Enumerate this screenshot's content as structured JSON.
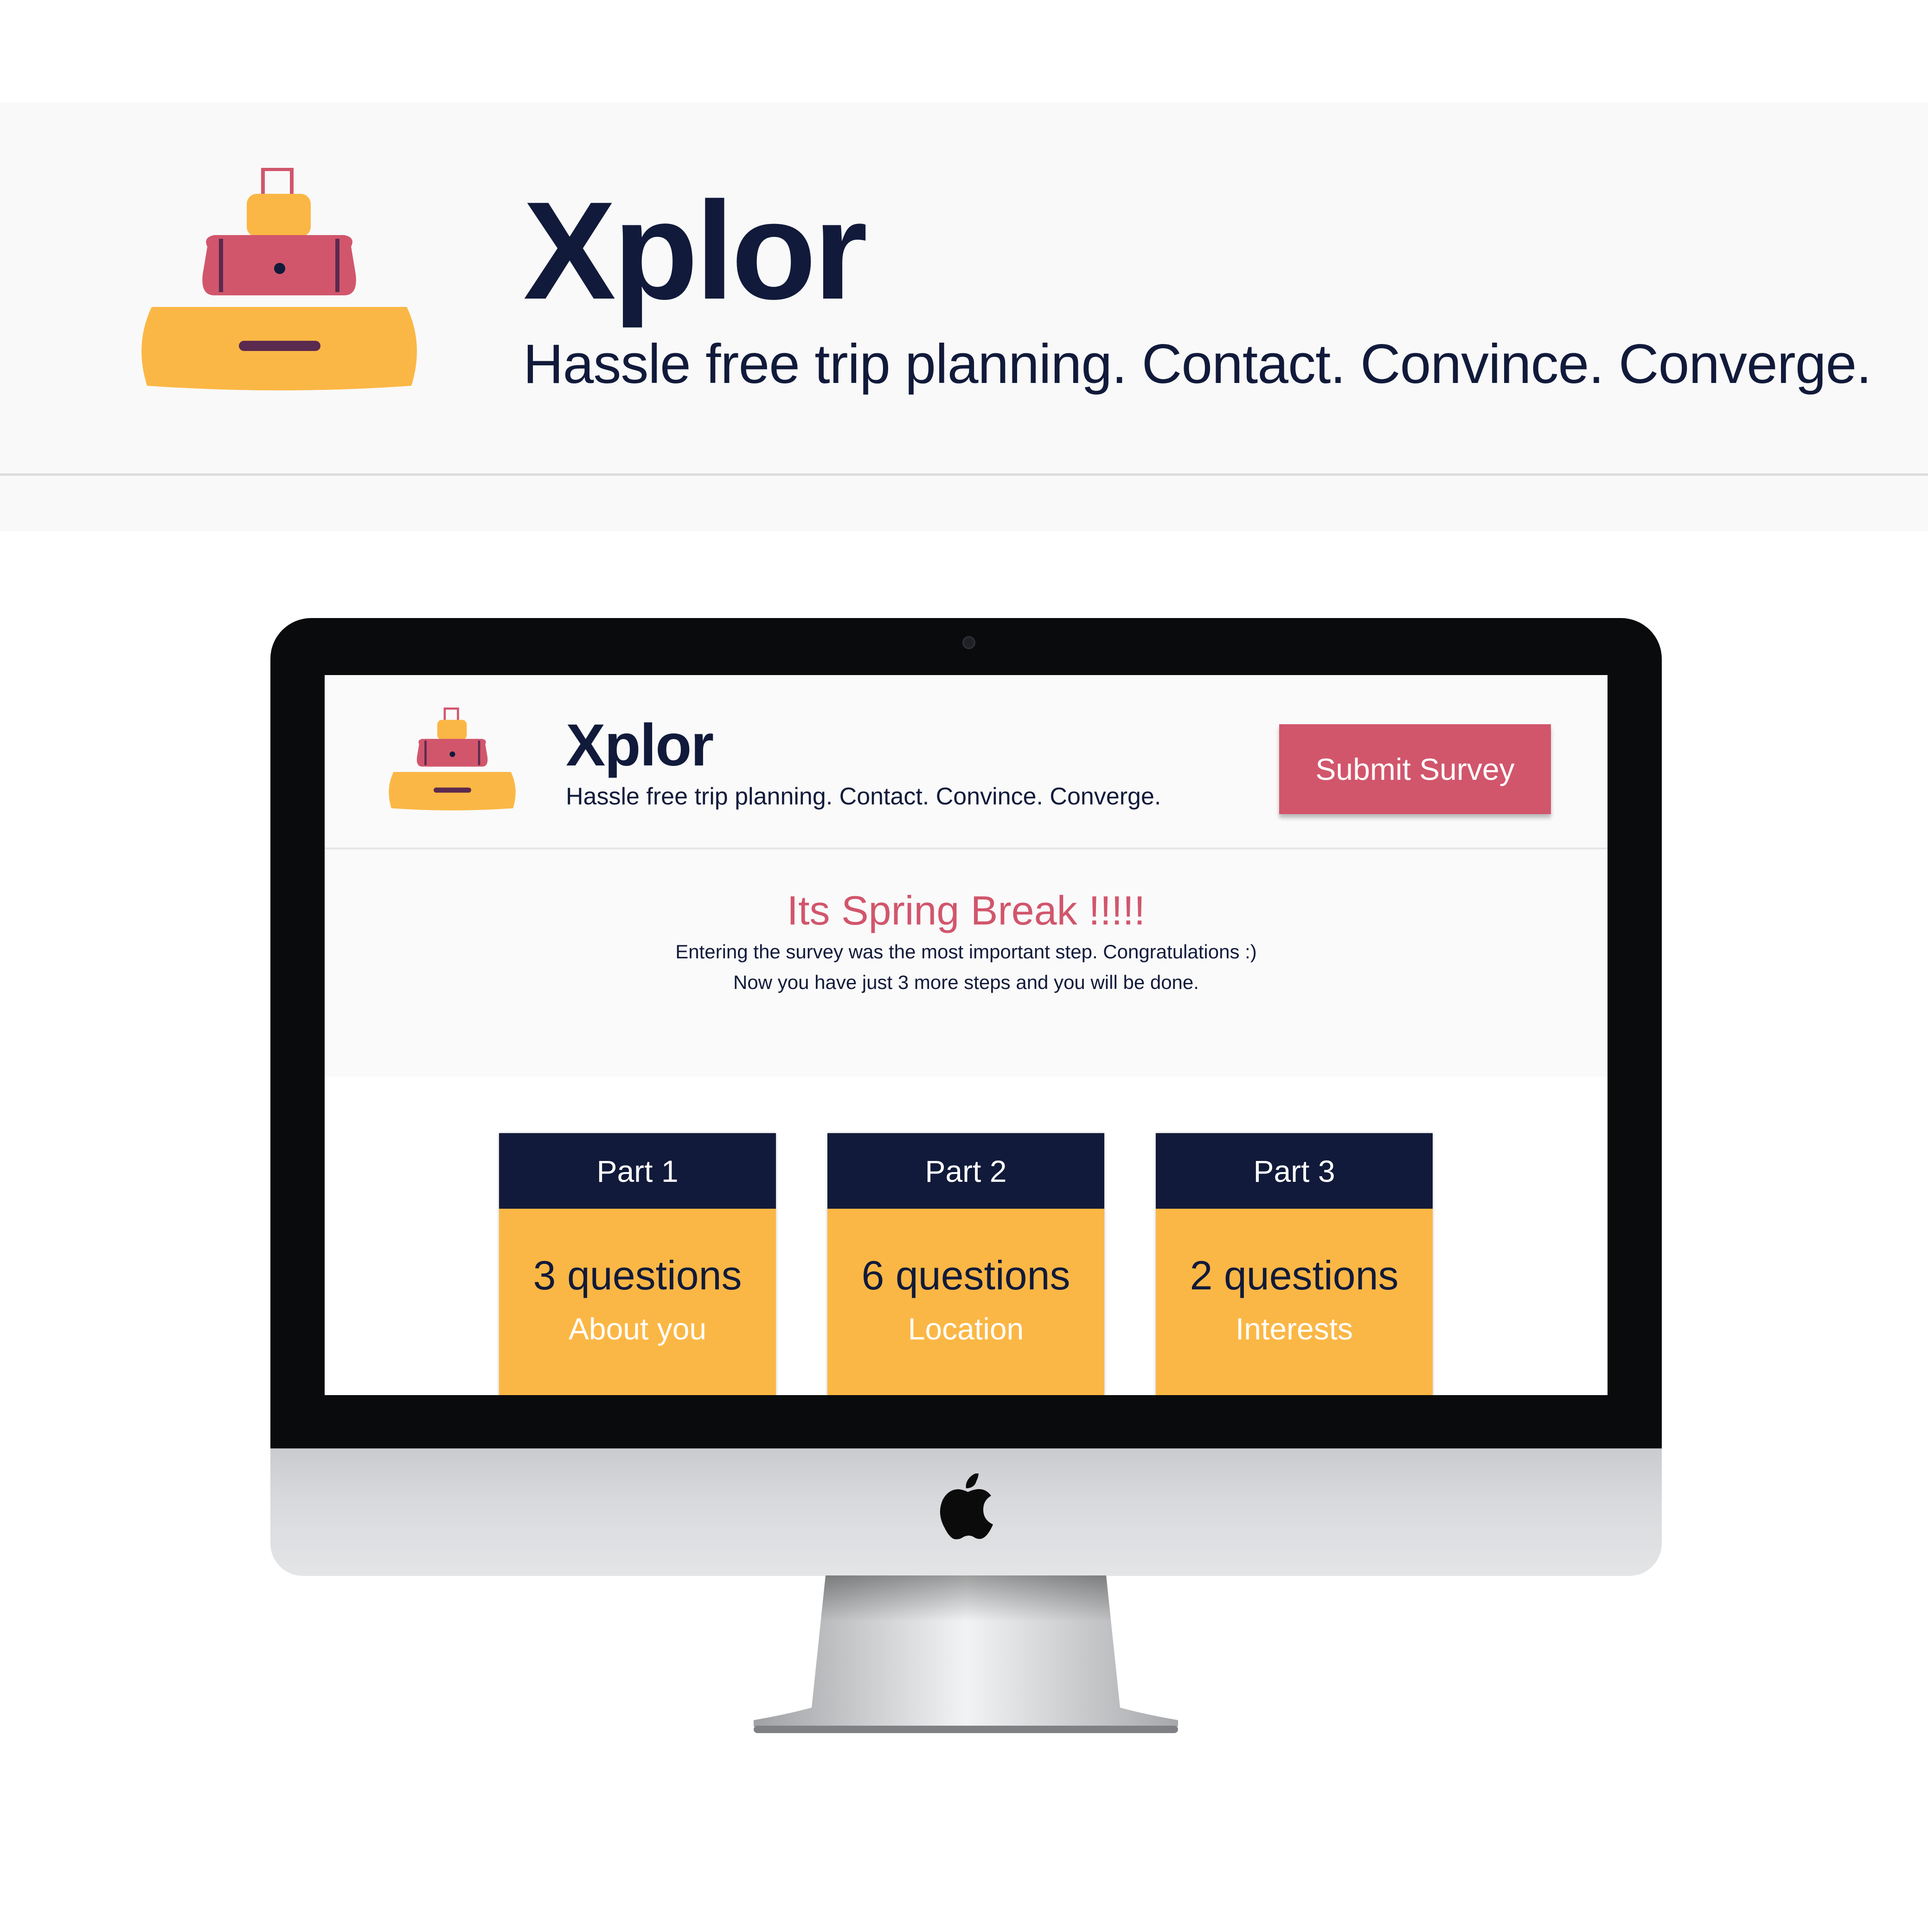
{
  "banner": {
    "brand": "Xplor",
    "tagline": "Hassle free trip planning. Contact. Convince. Converge."
  },
  "app": {
    "brand": "Xplor",
    "tagline": "Hassle free trip planning. Contact. Convince. Converge.",
    "submit_label": "Submit Survey"
  },
  "intro": {
    "title": "Its Spring Break !!!!!",
    "line1": "Entering the survey was the most important step. Congratulations :)",
    "line2": "Now you have just 3 more steps and you will be done."
  },
  "parts": [
    {
      "label": "Part 1",
      "count": "3 questions",
      "topic": "About you"
    },
    {
      "label": "Part 2",
      "count": "6 questions",
      "topic": "Location"
    },
    {
      "label": "Part 3",
      "count": "2 questions",
      "topic": "Interests"
    }
  ],
  "colors": {
    "navy": "#111a3a",
    "pink": "#d1566c",
    "yellow": "#fbb745",
    "purple_accent": "#5b2a4f"
  },
  "icons": {
    "logo": "luggage-stack-icon",
    "device_brand": "apple-logo-icon"
  }
}
